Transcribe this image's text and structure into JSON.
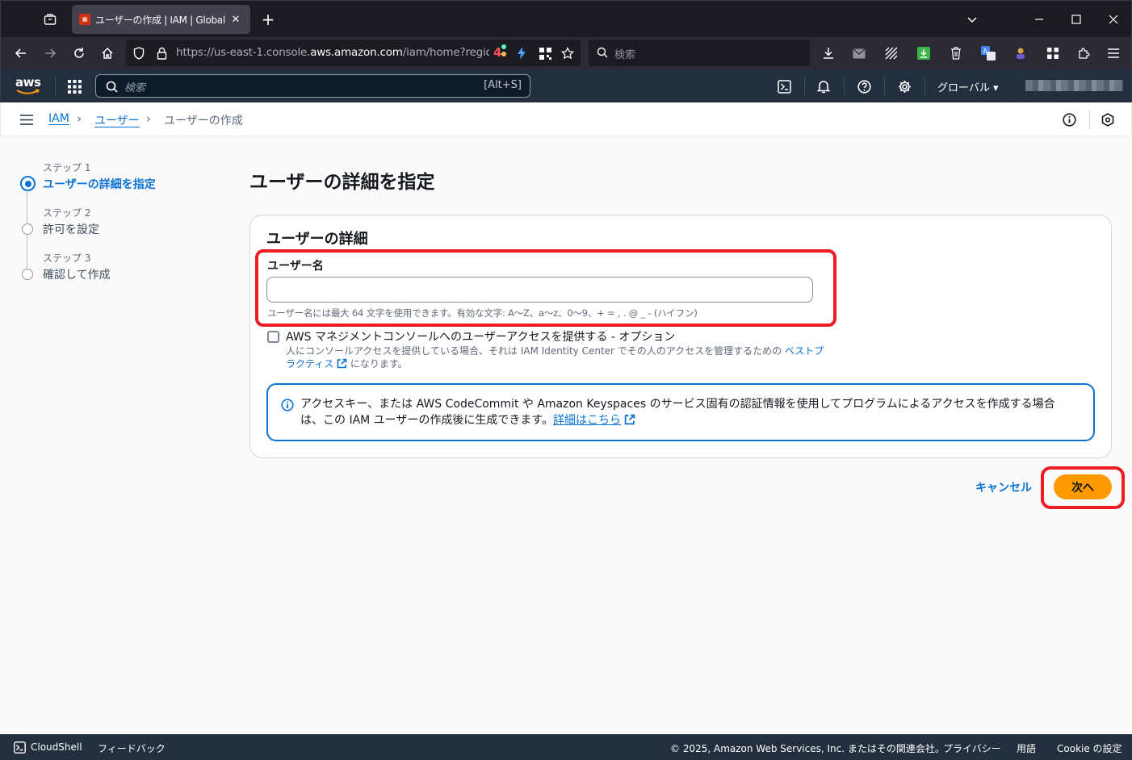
{
  "browser": {
    "tab_title": "ユーザーの作成 | IAM | Global",
    "tab_close": "✕",
    "new_tab": "+",
    "url_prefix": "https://us-east-1.console.",
    "url_domain": "aws.amazon.com",
    "url_suffix": "/iam/home?region=u",
    "search_placeholder": "検索",
    "addon_badge": "4"
  },
  "aws_header": {
    "logo": "aws",
    "search_placeholder": "検索",
    "search_shortcut": "[Alt+S]",
    "region": "グローバル ▾"
  },
  "breadcrumb": {
    "items": [
      "IAM",
      "ユーザー"
    ],
    "current": "ユーザーの作成",
    "separator": "›"
  },
  "steps": [
    {
      "label": "ステップ 1",
      "name": "ユーザーの詳細を指定"
    },
    {
      "label": "ステップ 2",
      "name": "許可を設定"
    },
    {
      "label": "ステップ 3",
      "name": "確認して作成"
    }
  ],
  "page": {
    "title": "ユーザーの詳細を指定",
    "card_title": "ユーザーの詳細",
    "username_label": "ユーザー名",
    "username_value": "",
    "username_hint": "ユーザー名には最大 64 文字を使用できます。有効な文字: A～Z、a～z、0～9、+ = , . @ _ - (ハイフン)",
    "console_access_label": "AWS マネジメントコンソールへのユーザーアクセスを提供する - オプション",
    "console_access_checked": false,
    "console_desc_pre": "人にコンソールアクセスを提供している場合、それは IAM Identity Center でその人のアクセスを管理するための ",
    "console_desc_link": "ベストプラクティス",
    "console_desc_post": " になります。",
    "info_text": "アクセスキー、または AWS CodeCommit や Amazon Keyspaces のサービス固有の認証情報を使用してプログラムによるアクセスを作成する場合は、この IAM ユーザーの作成後に生成できます。",
    "info_link": "詳細はこちら"
  },
  "actions": {
    "cancel": "キャンセル",
    "next": "次へ"
  },
  "footer": {
    "cloudshell": "CloudShell",
    "feedback": "フィードバック",
    "copyright": "© 2025, Amazon Web Services, Inc. またはその関連会社。",
    "privacy": "プライバシー",
    "terms": "用語",
    "cookie": "Cookie の設定"
  },
  "colors": {
    "aws_header": "#232f3e",
    "link": "#0972d3",
    "primary_button": "#ff9900",
    "highlight": "#ee1d23"
  }
}
